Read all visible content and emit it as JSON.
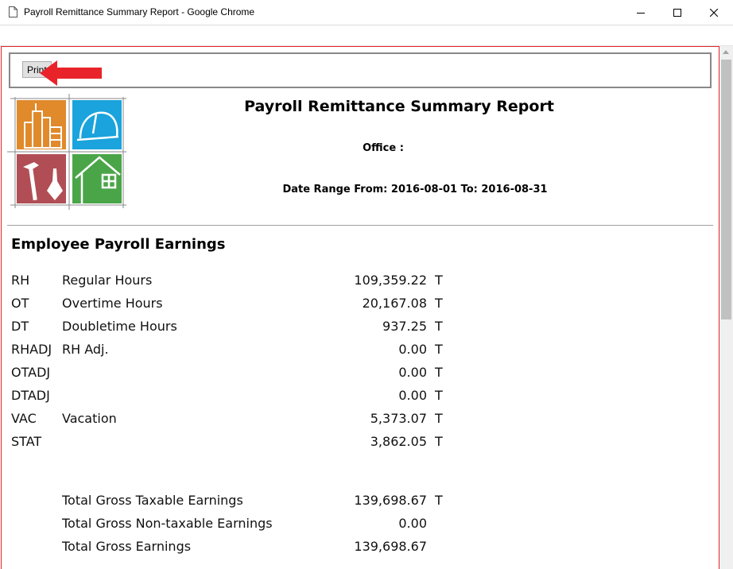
{
  "window": {
    "title": "Payroll Remittance Summary Report - Google Chrome"
  },
  "toolbar": {
    "print_label": "Print"
  },
  "report": {
    "title": "Payroll Remittance Summary Report",
    "office_label": "Office :",
    "date_range": "Date Range From: 2016-08-01 To: 2016-08-31"
  },
  "earnings": {
    "section_title": "Employee Payroll Earnings",
    "rows": [
      {
        "code": "RH",
        "desc": "Regular Hours",
        "amount": "109,359.22",
        "flag": "T"
      },
      {
        "code": "OT",
        "desc": "Overtime Hours",
        "amount": "20,167.08",
        "flag": "T"
      },
      {
        "code": "DT",
        "desc": "Doubletime Hours",
        "amount": "937.25",
        "flag": "T"
      },
      {
        "code": "RHADJ",
        "desc": "RH Adj.",
        "amount": "0.00",
        "flag": "T"
      },
      {
        "code": "OTADJ",
        "desc": "",
        "amount": "0.00",
        "flag": "T"
      },
      {
        "code": "DTADJ",
        "desc": "",
        "amount": "0.00",
        "flag": "T"
      },
      {
        "code": "VAC",
        "desc": "Vacation",
        "amount": "5,373.07",
        "flag": "T"
      },
      {
        "code": "STAT",
        "desc": "",
        "amount": "3,862.05",
        "flag": "T"
      }
    ],
    "totals": [
      {
        "desc": "Total Gross Taxable Earnings",
        "amount": "139,698.67",
        "flag": "T"
      },
      {
        "desc": "Total Gross Non-taxable Earnings",
        "amount": "0.00",
        "flag": ""
      },
      {
        "desc": "Total Gross Earnings",
        "amount": "139,698.67",
        "flag": ""
      }
    ]
  },
  "icons": {
    "page": "document-icon",
    "minimize": "minimize-icon",
    "maximize": "maximize-icon",
    "close": "close-icon",
    "pointer": "red-arrow-icon",
    "logo": "construction-logo-icon"
  },
  "colors": {
    "accent_red": "#e8242a",
    "logo_orange": "#e08a2c",
    "logo_blue": "#1aa3dc",
    "logo_maroon": "#b14e55",
    "logo_green": "#4aa548"
  }
}
